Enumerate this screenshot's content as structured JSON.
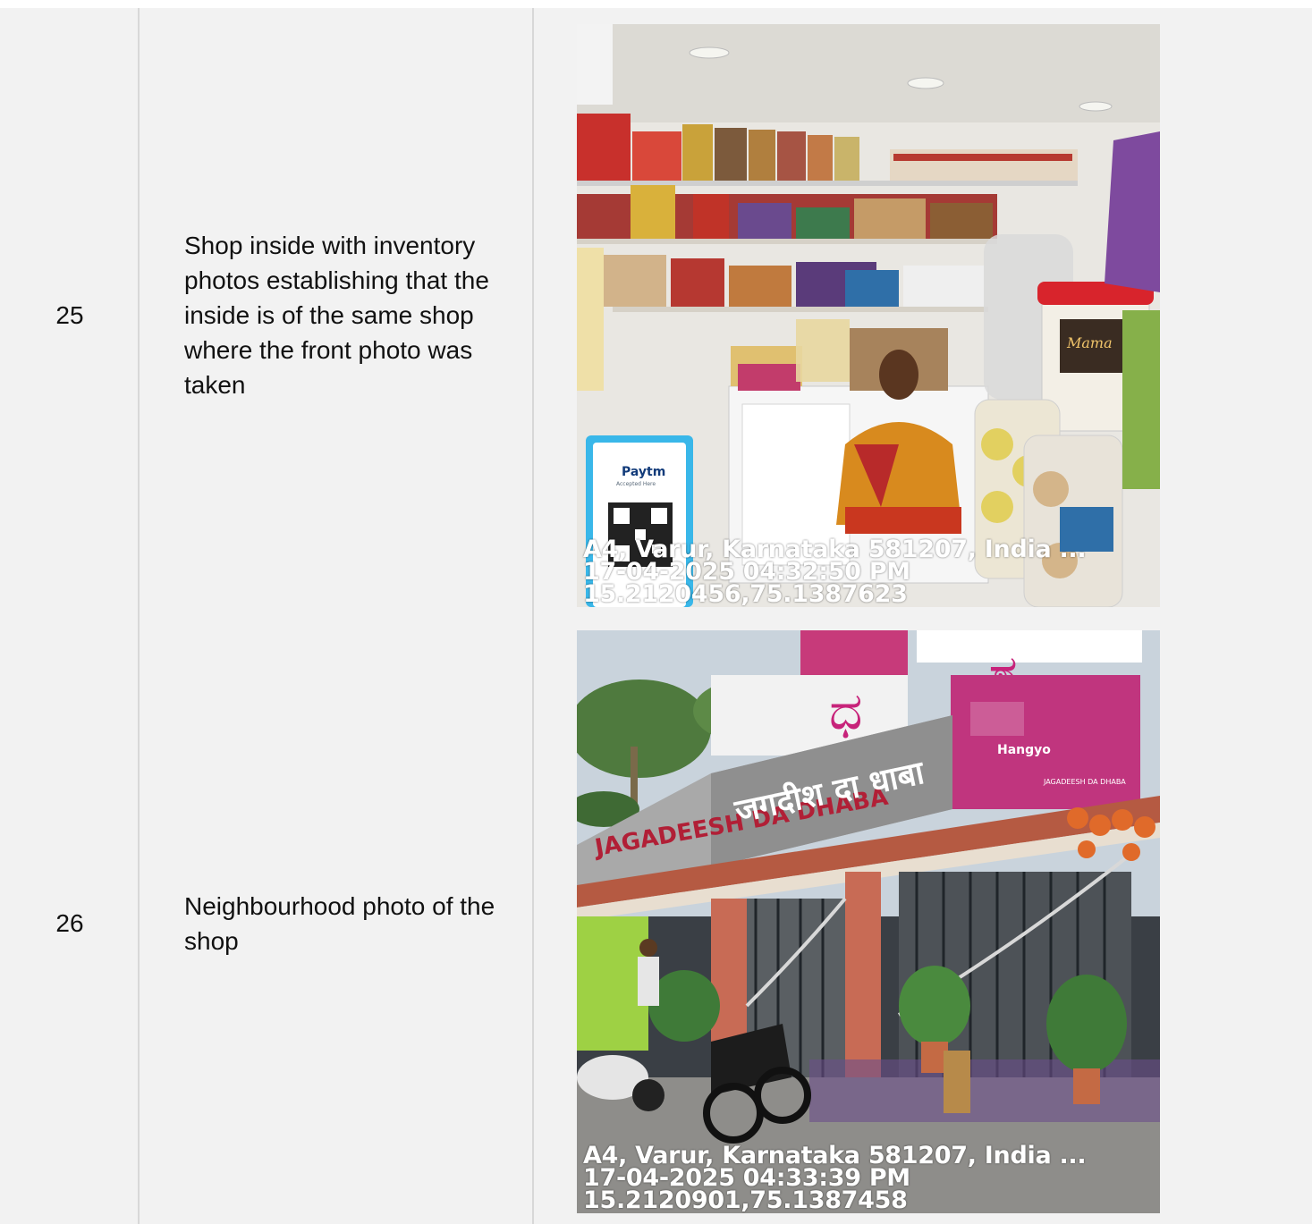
{
  "rows": [
    {
      "number": "25",
      "description": "Shop inside with inventory photos establishing that the inside is of the same shop where the front photo was taken",
      "photo": {
        "subject": "shop-interior",
        "overlay": {
          "address": "A4, Varur, Karnataka 581207, India ...",
          "datetime": "17-04-2025 04:32:50 PM",
          "coords": "15.2120456,75.1387623"
        },
        "sign_brand": "Paytm",
        "sign_text": "Accepted Here",
        "jar_label": "Mama"
      }
    },
    {
      "number": "26",
      "description": "Neighbourhood photo of the shop",
      "photo": {
        "subject": "shop-exterior",
        "overlay": {
          "address": "A4, Varur, Karnataka 581207, India ...",
          "datetime": "17-04-2025 04:33:39 PM",
          "coords": "15.2120901,75.1387458"
        },
        "sign_left": "JAGADEESH DA DHABA",
        "sign_hindi": "जगदीश दा धाबा",
        "banner_brand": "Hangyo",
        "banner_text": "JAGADEESH DA DHABA"
      }
    }
  ]
}
